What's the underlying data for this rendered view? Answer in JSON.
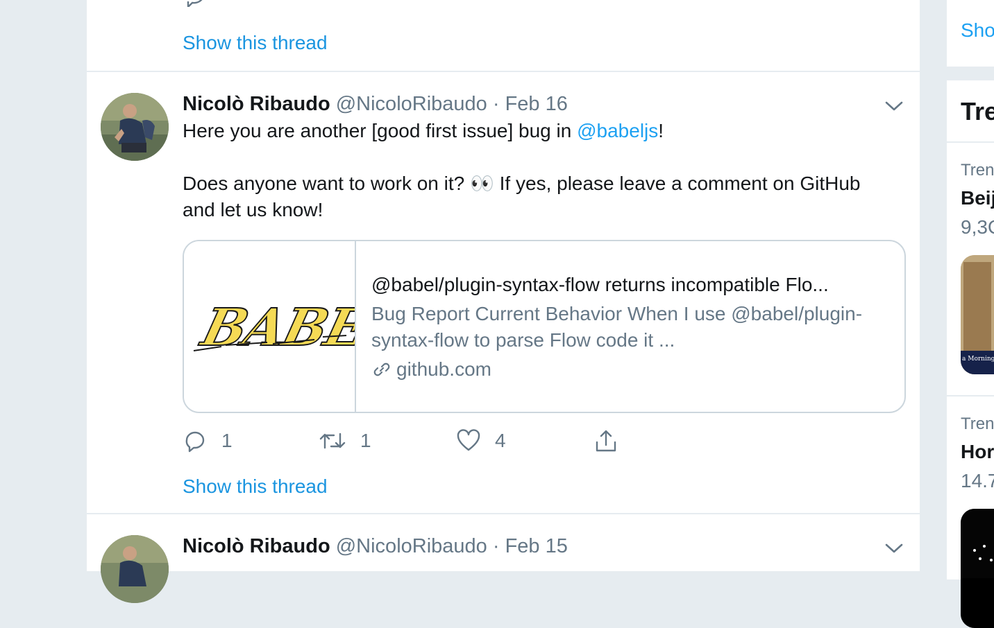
{
  "tweets": {
    "top": {
      "show_thread": "Show this thread"
    },
    "main": {
      "name": "Nicolò Ribaudo",
      "handle": "@NicoloRibaudo",
      "separator": "·",
      "date": "Feb 16",
      "text_part1": "Here you are another [good first issue] bug in ",
      "mention": "@babeljs",
      "text_part2": "!",
      "text_line2": "Does anyone want to work on it? 👀 If yes, please leave a comment on GitHub and let us know!",
      "card": {
        "image_icon": "babel-logo",
        "logo_text": "BABEL",
        "title": "@babel/plugin-syntax-flow returns incompatible Flo...",
        "description": "Bug Report Current Behavior When I use @babel/plugin-syntax-flow to parse Flow code it ...",
        "domain": "github.com"
      },
      "actions": {
        "reply_count": "1",
        "retweet_count": "1",
        "like_count": "4"
      },
      "show_thread": "Show this thread"
    },
    "bottom": {
      "name": "Nicolò Ribaudo",
      "handle": "@NicoloRibaudo",
      "separator": "·",
      "date": "Feb 15"
    }
  },
  "right_column": {
    "show_more_partial": "Sho",
    "trends_title_partial": "Tre",
    "trend1": {
      "label": "Tren",
      "name": "Beij",
      "count": "9,3C"
    },
    "trend2": {
      "label": "Tren",
      "name": "Hor",
      "count": "14.7"
    },
    "thumb1_caption": "a Morning P"
  },
  "colors": {
    "accent": "#1da1f2",
    "link": "#1b95e0",
    "secondary_text": "#657786",
    "border": "#e6ecf0",
    "babel_yellow": "#f5da55"
  }
}
